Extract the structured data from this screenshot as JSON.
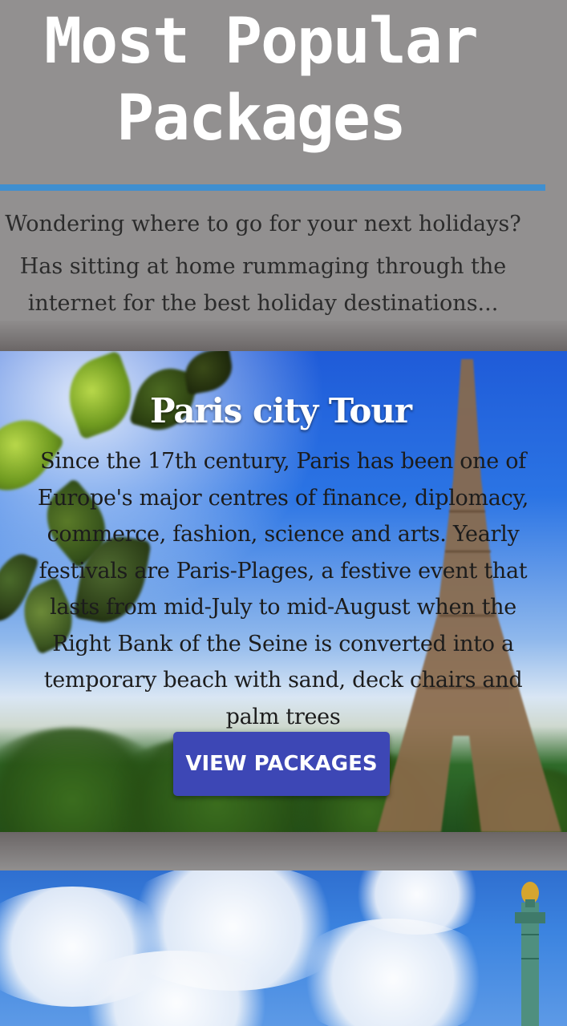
{
  "header": {
    "title_line1": "Most Popular",
    "title_line2": "Packages",
    "intro_line1": "Wondering where to go for your next holidays?",
    "intro_line2": "Has sitting at home rummaging through the internet for the best holiday destinations..."
  },
  "package": {
    "title": "Paris city Tour",
    "description": "Since the 17th century, Paris has been one of Europe's major centres of finance, diplomacy, commerce, fashion, science and arts. Yearly festivals are Paris-Plages, a festive event that lasts from mid-July to mid-August when the Right Bank of the Seine is converted into a temporary beach with sand, deck chairs and palm trees",
    "button_label": "VIEW PACKAGES"
  },
  "icons": {
    "background_image_1": "eiffel-tower-photo",
    "background_image_2": "statue-of-liberty-photo"
  },
  "colors": {
    "header_bg": "#929090",
    "divider": "#3f8fd0",
    "button_bg": "#3d47b5",
    "title_text": "#ffffff"
  }
}
